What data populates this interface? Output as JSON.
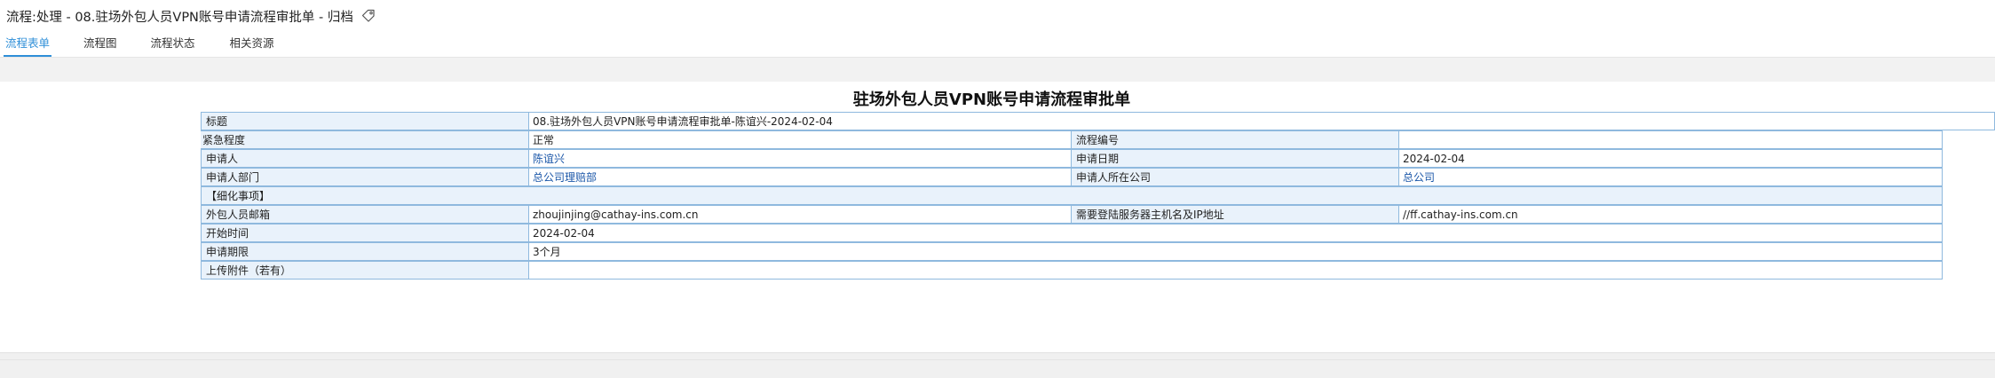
{
  "header": {
    "title": "流程:处理 - 08.驻场外包人员VPN账号申请流程审批单 - 归档",
    "tag_icon": "tag-icon",
    "tabs": [
      {
        "label": "流程表单",
        "active": true
      },
      {
        "label": "流程图",
        "active": false
      },
      {
        "label": "流程状态",
        "active": false
      },
      {
        "label": "相关资源",
        "active": false
      }
    ]
  },
  "form": {
    "title": "驻场外包人员VPN账号申请流程审批单",
    "rows": {
      "subject_label": "标题",
      "subject_value": "08.驻场外包人员VPN账号申请流程审批单-陈谊兴-2024-02-04",
      "urgency_label": "紧急程度",
      "urgency_value": "正常",
      "process_no_label": "流程编号",
      "process_no_value": "",
      "applicant_label": "申请人",
      "applicant_value": "陈谊兴",
      "apply_date_label": "申请日期",
      "apply_date_value": "2024-02-04",
      "dept_label": "申请人部门",
      "dept_value": "总公司理赔部",
      "company_label": "申请人所在公司",
      "company_value": "总公司",
      "section_label": "【细化事项】",
      "email_label": "外包人员邮箱",
      "email_value": "zhoujinjing@cathay-ins.com.cn",
      "host_label": "需要登陆服务器主机名及IP地址",
      "host_value": "//ff.cathay-ins.com.cn",
      "start_label": "开始时间",
      "start_value": "2024-02-04",
      "period_label": "申请期限",
      "period_value": "3个月",
      "attach_label": "上传附件（若有）",
      "attach_value": ""
    }
  },
  "colors": {
    "accent": "#2f8fd8",
    "label_bg": "#e9f2fb",
    "border": "#8fb9de",
    "link": "#1a56a8"
  }
}
